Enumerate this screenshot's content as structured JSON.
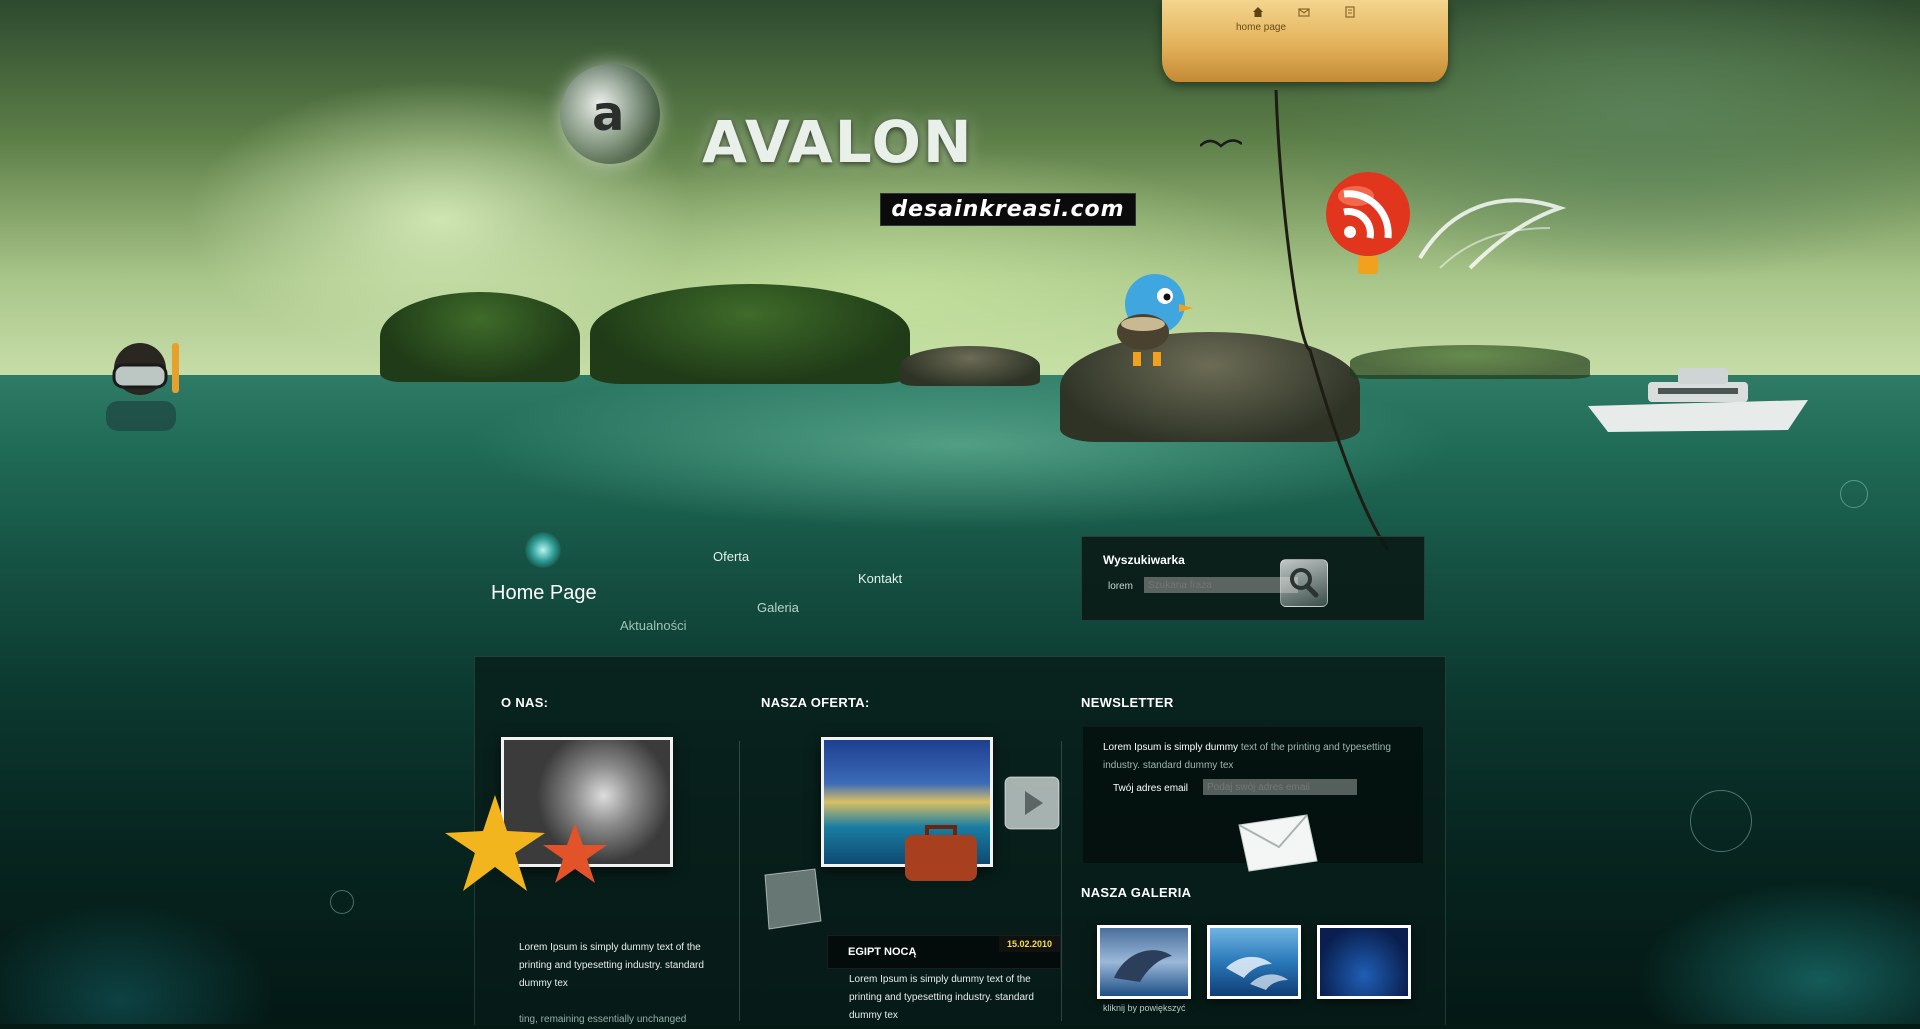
{
  "top_nav": {
    "active_label": "home page",
    "icons": [
      "home-icon",
      "mail-icon",
      "document-icon"
    ]
  },
  "logo": {
    "name": "AVALON",
    "watermark": "desainkreasi.com"
  },
  "main_nav": {
    "home": "Home Page",
    "oferta": "Oferta",
    "galeria": "Galeria",
    "kontakt": "Kontakt",
    "aktualnosci": "Aktualności"
  },
  "search": {
    "title": "Wyszukiwarka",
    "label": "lorem",
    "placeholder": "Szukana fraza"
  },
  "o_nas": {
    "title": "O NAS:",
    "text": "Lorem Ipsum is simply dummy text of the printing and typesetting industry. standard dummy tex",
    "text_faded": "ting, remaining essentially unchanged"
  },
  "oferta": {
    "title": "NASZA OFERTA:",
    "event_title": "EGIPT NOCĄ",
    "event_date": "15.02.2010",
    "text": "Lorem Ipsum is simply dummy text of the printing and typesetting industry. standard dummy tex"
  },
  "newsletter": {
    "title": "NEWSLETTER",
    "text_main": "Lorem Ipsum is simply dummy ",
    "text_muted": "text of the printing and typesetting industry. standard dummy tex",
    "email_label": "Twój adres email",
    "email_placeholder": "Podaj swój adres email"
  },
  "gallery": {
    "title": "NASZA GALERIA",
    "hint": "kliknij by powiększyć"
  },
  "colors": {
    "accent_yellow": "#f4e04d",
    "tab_gold": "#e3b25a",
    "sea_dark": "#0c3a30"
  }
}
